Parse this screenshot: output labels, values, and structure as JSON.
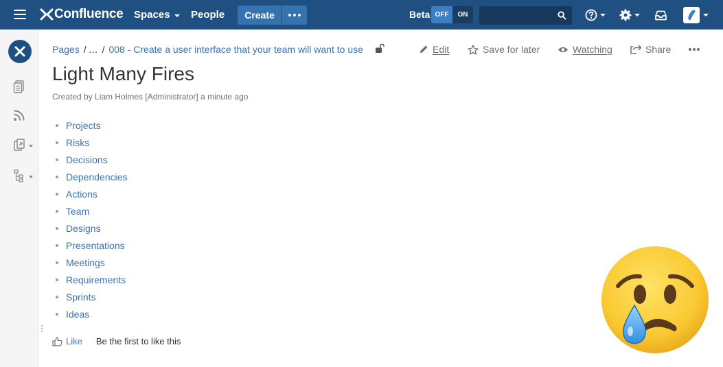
{
  "topnav": {
    "logo_text": "Confluence",
    "spaces_label": "Spaces",
    "people_label": "People",
    "create_label": "Create",
    "beta_label": "Beta",
    "toggle_off": "OFF",
    "toggle_on": "ON",
    "search_placeholder": "",
    "icons": [
      "hamburger-menu-icon",
      "more-icon",
      "search-icon",
      "help-icon",
      "settings-icon",
      "notifications-icon",
      "user-avatar"
    ]
  },
  "sidebar": {
    "icons": [
      "space-logo",
      "pages-icon",
      "blog-feed-icon",
      "shortcuts-icon",
      "page-tree-icon"
    ]
  },
  "breadcrumb": {
    "root": "Pages",
    "sep1": "/",
    "ellipsis": "…",
    "sep2": "/",
    "parent": "008 - Create a user interface that your team will want to use"
  },
  "page_actions": {
    "edit": "Edit",
    "save": "Save for later",
    "watching": "Watching",
    "share": "Share"
  },
  "page": {
    "title": "Light Many Fires",
    "byline": "Created by Liam Holmes [Administrator] a minute ago",
    "items": [
      {
        "label": "Projects"
      },
      {
        "label": "Risks"
      },
      {
        "label": "Decisions"
      },
      {
        "label": "Dependencies"
      },
      {
        "label": "Actions"
      },
      {
        "label": "Team"
      },
      {
        "label": "Designs"
      },
      {
        "label": "Presentations"
      },
      {
        "label": "Meetings"
      },
      {
        "label": "Requirements"
      },
      {
        "label": "Sprints"
      },
      {
        "label": "Ideas"
      }
    ]
  },
  "like": {
    "label": "Like",
    "text": "Be the first to like this"
  },
  "colors": {
    "header": "#205081",
    "create": "#3572b0",
    "link": "#3b73af",
    "emoji_face": "#f9c932",
    "tear": "#4aa6e8"
  }
}
